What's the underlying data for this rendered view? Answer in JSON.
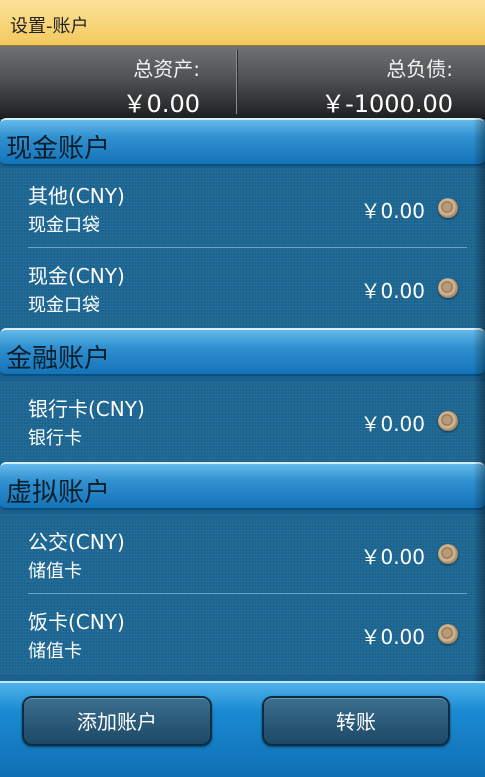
{
  "title": "设置-账户",
  "summary": {
    "assets_label": "总资产:",
    "assets_value": "￥0.00",
    "liabilities_label": "总负债:",
    "liabilities_value": "￥-1000.00"
  },
  "sections": [
    {
      "title": "现金账户",
      "accounts": [
        {
          "name": "其他(CNY)",
          "type": "现金口袋",
          "balance": "￥0.00"
        },
        {
          "name": "现金(CNY)",
          "type": "现金口袋",
          "balance": "￥0.00"
        }
      ]
    },
    {
      "title": "金融账户",
      "accounts": [
        {
          "name": "银行卡(CNY)",
          "type": "银行卡",
          "balance": "￥0.00"
        }
      ]
    },
    {
      "title": "虚拟账户",
      "accounts": [
        {
          "name": "公交(CNY)",
          "type": "储值卡",
          "balance": "￥0.00"
        },
        {
          "name": "饭卡(CNY)",
          "type": "储值卡",
          "balance": "￥0.00"
        }
      ]
    }
  ],
  "buttons": {
    "add_account": "添加账户",
    "transfer": "转账"
  },
  "colors": {
    "title_bar": "#f3c95e",
    "section_header": "#2f8fcf",
    "row_background": "#1d6794",
    "button": "#1c4966"
  }
}
